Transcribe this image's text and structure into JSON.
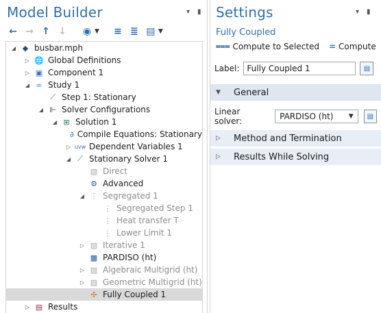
{
  "model_builder": {
    "title": "Model Builder",
    "toolbar": [
      {
        "name": "back-arrow-icon",
        "glyph": "←",
        "enabled": true
      },
      {
        "name": "forward-arrow-icon",
        "glyph": "→",
        "enabled": false
      },
      {
        "name": "move-up-icon",
        "glyph": "↑",
        "enabled": true
      },
      {
        "name": "move-down-icon",
        "glyph": "↓",
        "enabled": false
      },
      {
        "name": "show-options-icon",
        "glyph": "◉",
        "enabled": true
      },
      {
        "name": "collapse-all-icon",
        "glyph": "≡",
        "enabled": true
      },
      {
        "name": "expand-all-icon",
        "glyph": "≣",
        "enabled": true
      },
      {
        "name": "view-options-icon",
        "glyph": "▤",
        "enabled": true
      }
    ],
    "tree": [
      {
        "label": "busbar.mph",
        "depth": 0,
        "twisty": "open",
        "icon": "model-file-icon",
        "glyph": "◆",
        "color": "#2c4a7a",
        "dim": false
      },
      {
        "label": "Global Definitions",
        "depth": 1,
        "twisty": "closed",
        "icon": "globe-icon",
        "glyph": "🌐",
        "color": "#3a6db2",
        "dim": false
      },
      {
        "label": "Component 1",
        "depth": 1,
        "twisty": "closed",
        "icon": "component-icon",
        "glyph": "▣",
        "color": "#3a6db2",
        "dim": false
      },
      {
        "label": "Study 1",
        "depth": 1,
        "twisty": "open",
        "icon": "study-icon",
        "glyph": "∞",
        "color": "#3a7bbf",
        "dim": false
      },
      {
        "label": "Step 1: Stationary",
        "depth": 2,
        "twisty": "none",
        "icon": "stationary-step-icon",
        "glyph": "⟋",
        "color": "#2a7a4a",
        "dim": false
      },
      {
        "label": "Solver Configurations",
        "depth": 2,
        "twisty": "open",
        "icon": "solver-configurations-icon",
        "glyph": "⊩",
        "color": "#333333",
        "dim": false
      },
      {
        "label": "Solution 1",
        "depth": 3,
        "twisty": "open",
        "icon": "solution-icon",
        "glyph": "⊞",
        "color": "#2a7a4a",
        "dim": false
      },
      {
        "label": "Compile Equations: Stationary",
        "depth": 4,
        "twisty": "none",
        "icon": "compile-equations-icon",
        "glyph": "∂",
        "color": "#3a6db2",
        "dim": false
      },
      {
        "label": "Dependent Variables 1",
        "depth": 4,
        "twisty": "closed",
        "icon": "dependent-variables-icon",
        "glyph": "uvw",
        "color": "#3a6db2",
        "dim": false
      },
      {
        "label": "Stationary Solver 1",
        "depth": 4,
        "twisty": "open",
        "icon": "stationary-solver-icon",
        "glyph": "⟋",
        "color": "#2a7a4a",
        "dim": false
      },
      {
        "label": "Direct",
        "depth": 5,
        "twisty": "none",
        "icon": "direct-solver-icon",
        "glyph": "▧",
        "color": "#a8a8a8",
        "dim": true
      },
      {
        "label": "Advanced",
        "depth": 5,
        "twisty": "none",
        "icon": "advanced-icon",
        "glyph": "⚙",
        "color": "#2b5aa0",
        "dim": false
      },
      {
        "label": "Segregated 1",
        "depth": 5,
        "twisty": "open",
        "icon": "segregated-icon",
        "glyph": "⋮",
        "color": "#a8a8a8",
        "dim": true
      },
      {
        "label": "Segregated Step 1",
        "depth": 6,
        "twisty": "none",
        "icon": "segregated-step-icon",
        "glyph": "⋮",
        "color": "#a8a8a8",
        "dim": true
      },
      {
        "label": "Heat transfer T",
        "depth": 6,
        "twisty": "none",
        "icon": "segregated-step-icon",
        "glyph": "⋮",
        "color": "#a8a8a8",
        "dim": true
      },
      {
        "label": "Lower Limit 1",
        "depth": 6,
        "twisty": "none",
        "icon": "lower-limit-icon",
        "glyph": "⋮",
        "color": "#a8a8a8",
        "dim": true
      },
      {
        "label": "Iterative 1",
        "depth": 5,
        "twisty": "closed",
        "icon": "iterative-solver-icon",
        "glyph": "▨",
        "color": "#a8a8a8",
        "dim": true
      },
      {
        "label": "PARDISO (ht)",
        "depth": 5,
        "twisty": "none",
        "icon": "direct-solver-icon",
        "glyph": "▩",
        "color": "#2b5aa0",
        "dim": false
      },
      {
        "label": "Algebraic Multigrid (ht)",
        "depth": 5,
        "twisty": "closed",
        "icon": "multigrid-icon",
        "glyph": "▨",
        "color": "#a8a8a8",
        "dim": true
      },
      {
        "label": "Geometric Multigrid (ht)",
        "depth": 5,
        "twisty": "closed",
        "icon": "multigrid-icon",
        "glyph": "▨",
        "color": "#a8a8a8",
        "dim": true
      },
      {
        "label": "Fully Coupled 1",
        "depth": 5,
        "twisty": "none",
        "icon": "fully-coupled-icon",
        "glyph": "✣",
        "color": "#d97a1a",
        "dim": false,
        "selected": true
      },
      {
        "label": "Results",
        "depth": 1,
        "twisty": "closed",
        "icon": "results-icon",
        "glyph": "▤",
        "color": "#a03060",
        "dim": false
      }
    ]
  },
  "settings": {
    "title": "Settings",
    "subtitle": "Fully Coupled",
    "compute_to_selected": "Compute to Selected",
    "compute": "Compute",
    "label_caption": "Label:",
    "label_value": "Fully Coupled 1",
    "sections": {
      "general": "General",
      "method": "Method and Termination",
      "results": "Results While Solving"
    },
    "linear_solver_caption": "Linear solver:",
    "linear_solver_value": "PARDISO (ht)"
  },
  "colors": {
    "title_blue": "#2f6fa7",
    "section_bg": "#dde6f1",
    "selected_row": "#d9d9d9"
  }
}
